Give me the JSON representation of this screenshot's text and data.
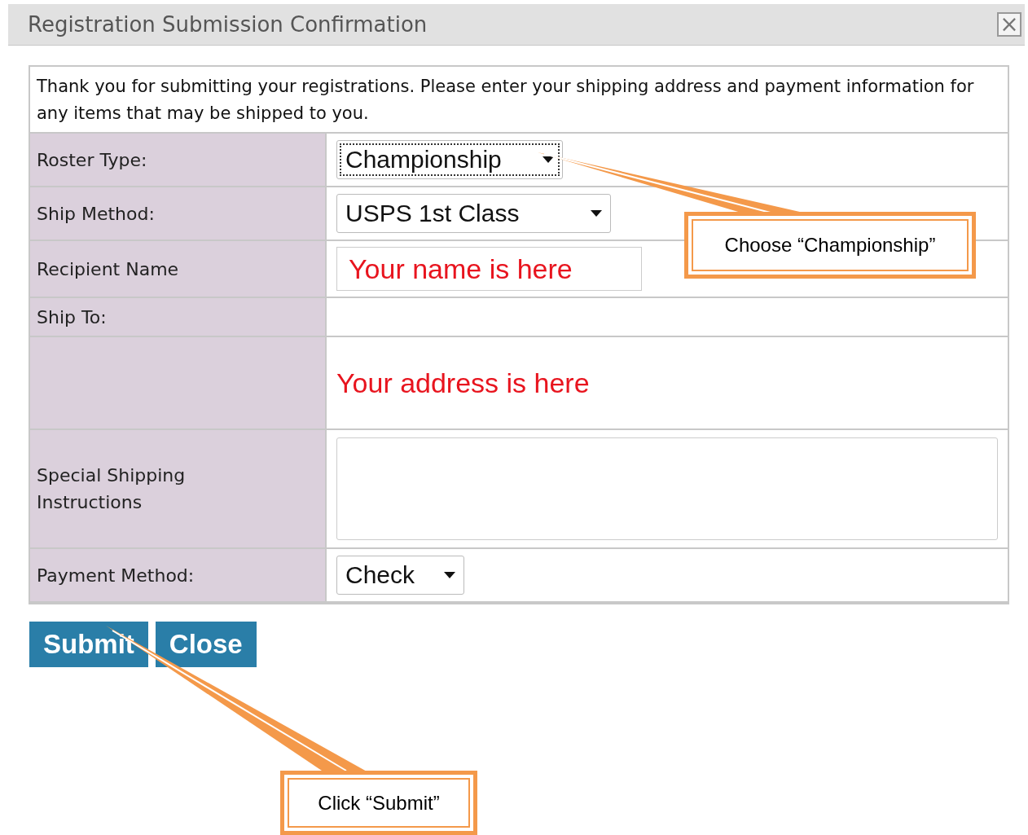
{
  "window": {
    "title": "Registration Submission Confirmation",
    "close": "×"
  },
  "intro": "Thank you for submitting your registrations. Please enter your shipping address and payment information for any items that may be shipped to you.",
  "fields": [
    {
      "kind": "select",
      "label": "Roster Type:",
      "value": "Championship",
      "focused": true
    },
    {
      "kind": "select",
      "label": "Ship Method:",
      "value": "USPS 1st Class",
      "focused": false
    },
    {
      "kind": "input",
      "label": "Recipient Name",
      "value": "Your name is here"
    },
    {
      "kind": "heading",
      "label": "Ship To:"
    },
    {
      "kind": "text",
      "value": "Your address is here"
    },
    {
      "kind": "textarea",
      "label": "Special Shipping Instructions"
    },
    {
      "kind": "select",
      "label": "Payment Method:",
      "value": "Check",
      "focused": false
    }
  ],
  "buttons": [
    {
      "label": "Submit"
    },
    {
      "label": "Close"
    }
  ],
  "callouts": [
    {
      "text": "Choose “Championship”"
    },
    {
      "text": "Click “Submit”"
    }
  ]
}
